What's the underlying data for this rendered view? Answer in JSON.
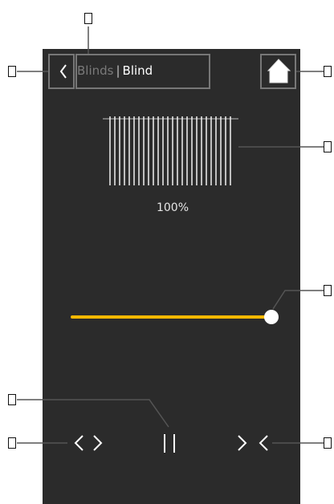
{
  "header": {
    "breadcrumb_parent": "Blinds",
    "breadcrumb_separator": "|",
    "breadcrumb_current": "Blind"
  },
  "blind": {
    "position_label": "100%",
    "position_value": 100
  },
  "slider": {
    "value_fraction": 1.0,
    "track_color": "#f5b800",
    "thumb_color": "#ffffff"
  },
  "controls": {
    "open_icon": "chevrons-apart-icon",
    "stop_icon": "pause-icon",
    "close_icon": "chevrons-together-icon"
  },
  "icons": {
    "back": "back-chevron-icon",
    "home": "home-icon",
    "blind": "blind-slats-icon"
  },
  "colors": {
    "screen_background": "#2b2b2b",
    "accent": "#f5b800",
    "icon": "#ffffff"
  }
}
